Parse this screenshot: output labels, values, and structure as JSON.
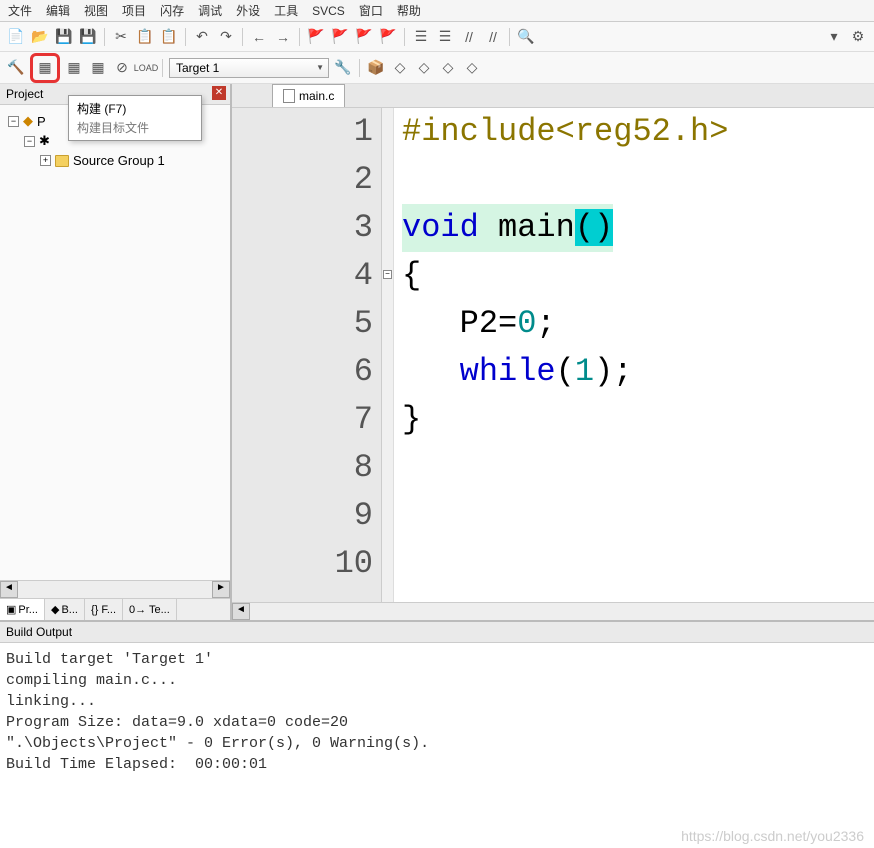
{
  "menu": {
    "items": [
      "文件",
      "编辑",
      "视图",
      "项目",
      "闪存",
      "调试",
      "外设",
      "工具",
      "SVCS",
      "窗口",
      "帮助"
    ]
  },
  "toolbar2": {
    "target": "Target 1"
  },
  "tooltip": {
    "title": "构建 (F7)",
    "sub": "构建目标文件"
  },
  "project": {
    "title": "Project",
    "tree": {
      "root_short": "P",
      "child_icon": "✱",
      "source_group": "Source Group 1"
    },
    "tabs": [
      "Pr...",
      "B...",
      "{} F...",
      "0→ Te..."
    ]
  },
  "editor": {
    "tab": "main.c",
    "lines": {
      "l1_pp": "#include<reg52.h>",
      "l3_kw": "void",
      "l3_fn": " main",
      "l3_paren": "()",
      "l4": "{",
      "l5_a": "   P2=",
      "l5_n": "0",
      "l5_b": ";",
      "l6_a": "   ",
      "l6_kw": "while",
      "l6_b": "(",
      "l6_n": "1",
      "l6_c": ");",
      "l7": "}"
    },
    "line_numbers": [
      "1",
      "2",
      "3",
      "4",
      "5",
      "6",
      "7",
      "8",
      "9",
      "10"
    ]
  },
  "build": {
    "title": "Build Output",
    "text": "Build target 'Target 1'\ncompiling main.c...\nlinking...\nProgram Size: data=9.0 xdata=0 code=20\n\".\\Objects\\Project\" - 0 Error(s), 0 Warning(s).\nBuild Time Elapsed:  00:00:01"
  },
  "watermark": "https://blog.csdn.net/you2336"
}
